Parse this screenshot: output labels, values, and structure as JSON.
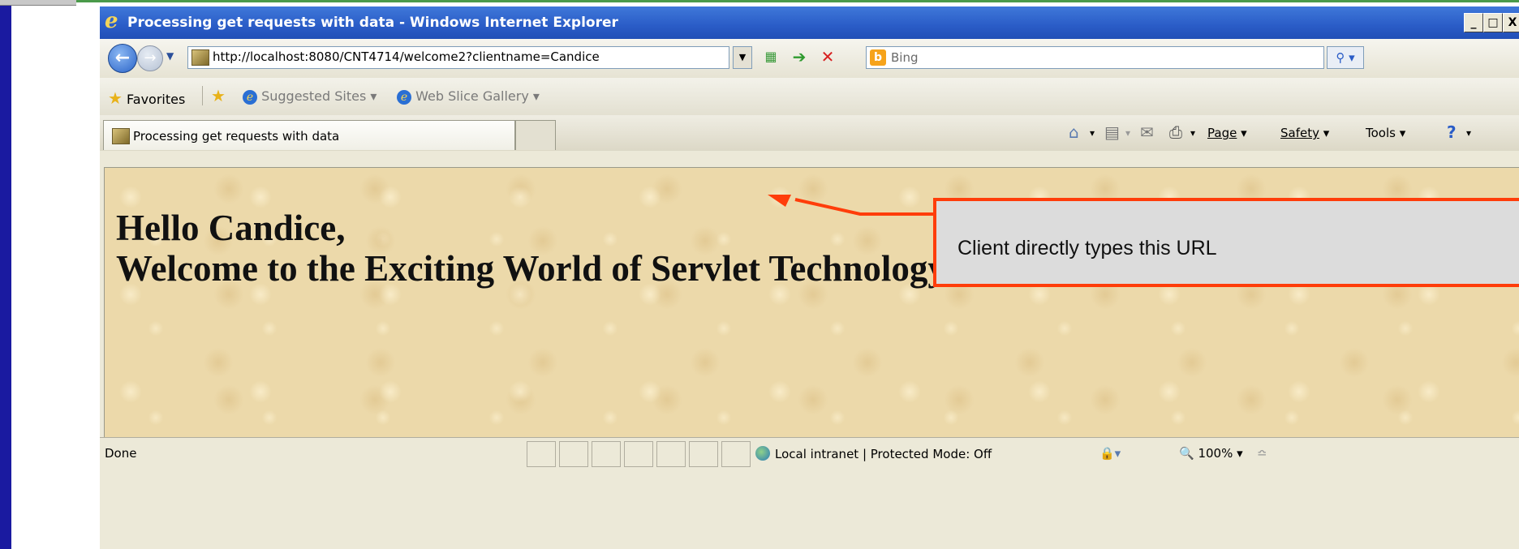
{
  "window": {
    "title": "Processing get requests with data - Windows Internet Explorer",
    "controls": [
      "_",
      "□",
      "X"
    ]
  },
  "address_bar": {
    "url": "http://localhost:8080/CNT4714/welcome2?clientname=Candice",
    "search_value": "Bing"
  },
  "favorites_bar": {
    "favorites_label": "Favorites",
    "items": [
      "Suggested Sites ▾",
      "Web Slice Gallery ▾"
    ]
  },
  "tabs": [
    {
      "label": "Processing get requests with data"
    }
  ],
  "command_bar": {
    "page": "Page",
    "safety": "Safety",
    "tools": "Tools"
  },
  "page": {
    "greeting": "Hello Candice,",
    "welcome": "Welcome to the Exciting World of Servlet Technology!"
  },
  "status_bar": {
    "status": "Done",
    "zone": "Local intranet | Protected Mode: Off",
    "zoom": "100%"
  },
  "annotation": {
    "text": "Client directly types this URL",
    "color": "#ff3d0a"
  }
}
